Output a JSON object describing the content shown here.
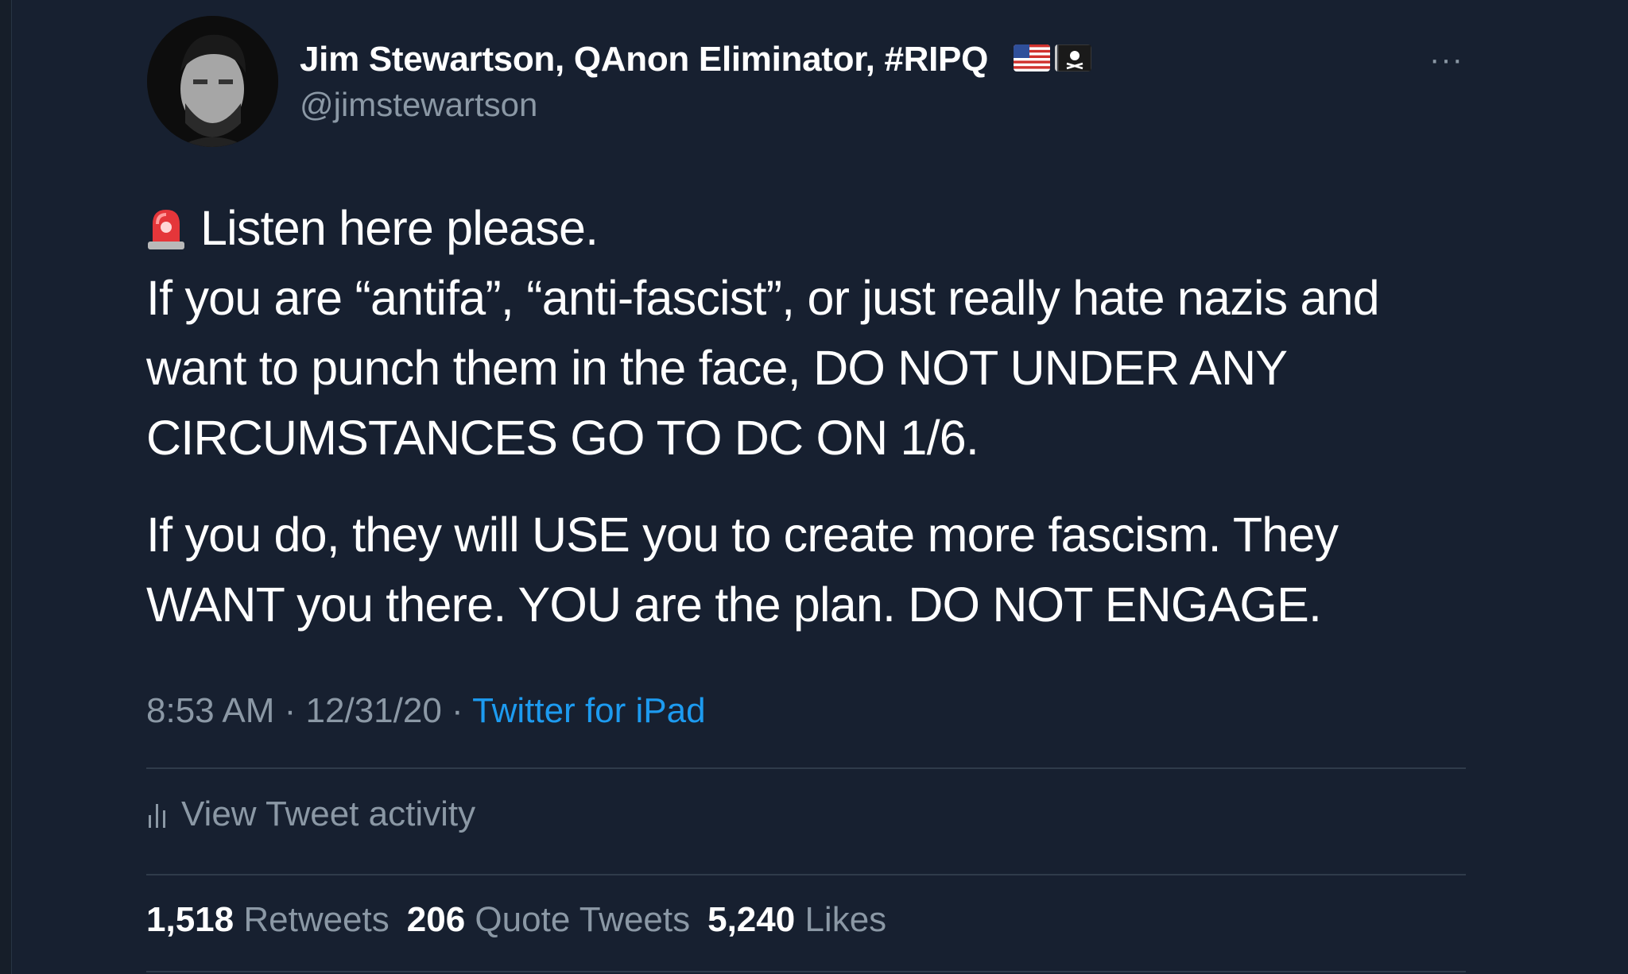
{
  "tweet": {
    "author": {
      "display_name": "Jim Stewartson, QAnon Eliminator, #RIPQ",
      "handle": "@jimstewartson",
      "badges": [
        "us-flag-icon",
        "pirate-flag-icon"
      ]
    },
    "more_label": "···",
    "body": {
      "line1": "Listen here please.",
      "line2": "If you are “antifa”, “anti-fascist”, or just really hate nazis and",
      "line3": "want to punch them in the face, DO NOT UNDER ANY",
      "line4": "CIRCUMSTANCES GO TO DC ON 1/6.",
      "line5": "If you do, they will USE you to create more fascism. They",
      "line6": "WANT you there. YOU are the plan. DO NOT ENGAGE."
    },
    "meta": {
      "time": "8:53 AM",
      "separator": " · ",
      "date": "12/31/20",
      "source": "Twitter for iPad"
    },
    "activity_label": "View Tweet activity",
    "stats": {
      "retweets_count": "1,518",
      "retweets_label": "Retweets",
      "quotes_count": "206",
      "quotes_label": "Quote Tweets",
      "likes_count": "5,240",
      "likes_label": "Likes"
    }
  },
  "colors": {
    "background": "#172030",
    "secondary_text": "#8b98a5",
    "link": "#1d9bf0"
  }
}
